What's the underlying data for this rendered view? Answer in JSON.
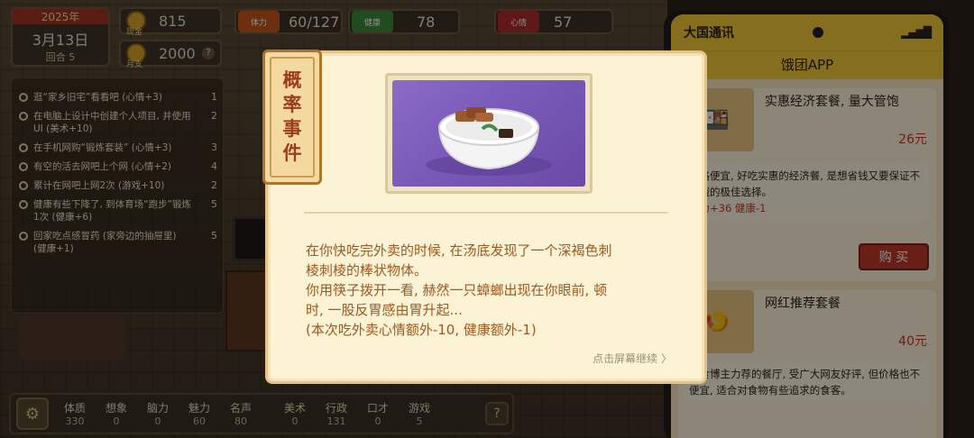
{
  "date": {
    "year": "2025年",
    "month_day": "3月13日",
    "round": "回合 5"
  },
  "money": {
    "cash_label": "现金",
    "cash_value": "815",
    "monthly_label": "月支",
    "monthly_value": "2000"
  },
  "resources": [
    {
      "label": "体力",
      "value": "60/127",
      "color": "#c8541e"
    },
    {
      "label": "健康",
      "value": "78",
      "color": "#3d8a3a"
    },
    {
      "label": "心情",
      "value": "57",
      "color": "#b02a2a"
    }
  ],
  "quests": [
    {
      "text": "逛“家乡旧宅”看看吧 (心情+3)",
      "num": "1"
    },
    {
      "text": "在电脑上设计中创建个人项目, 并使用UI (美术+10)",
      "num": "2"
    },
    {
      "text": "在手机网购“锻炼套装” (心情+3)",
      "num": "3"
    },
    {
      "text": "有空的活去网吧上个网 (心情+2)",
      "num": "4"
    },
    {
      "text": "累计在网吧上网2次 (游戏+10)",
      "num": "2"
    },
    {
      "text": "健康有些下降了, 到体育场“跑步”锻炼1次 (健康+6)",
      "num": "5"
    },
    {
      "text": "回家吃点感冒药 (家旁边的抽屉里) (健康+1)",
      "num": "5"
    }
  ],
  "attributes": [
    {
      "label": "体质",
      "value": "330"
    },
    {
      "label": "想象",
      "value": "0"
    },
    {
      "label": "脑力",
      "value": "0"
    },
    {
      "label": "魅力",
      "value": "60"
    },
    {
      "label": "名声",
      "value": "80"
    },
    {
      "label": "美术",
      "value": "0"
    },
    {
      "label": "行政",
      "value": "131"
    },
    {
      "label": "口才",
      "value": "0"
    },
    {
      "label": "游戏",
      "value": "5"
    }
  ],
  "phone": {
    "carrier": "大国通讯",
    "app_name": "饿团APP",
    "items": [
      {
        "name": "实惠经济套餐, 量大管饱",
        "price": "26元",
        "desc": "价格便宜, 好吃实惠的经济餐, 是想省钱又要保证不挨饿的极佳选择。",
        "effect": "体力+36 健康-1",
        "buy_label": "购 买"
      },
      {
        "name": "网红推荐套餐",
        "price": "40元",
        "desc": "美食博主力荐的餐厅, 受广大网友好评, 但价格也不便宜, 适合对食物有些追求的食客。"
      }
    ]
  },
  "event": {
    "tag_chars": [
      "概",
      "率",
      "事",
      "件"
    ],
    "lines": [
      "在你快吃完外卖的时候, 在汤底发现了一个深褐色刺",
      "棱刺棱的棒状物体。",
      "你用筷子拨开一看, 赫然一只蟑螂出现在你眼前, 顿",
      "时, 一股反胃感由胃升起...",
      "(本次吃外卖心情额外-10, 健康额外-1)"
    ],
    "continue_label": "点击屏幕继续 〉"
  }
}
